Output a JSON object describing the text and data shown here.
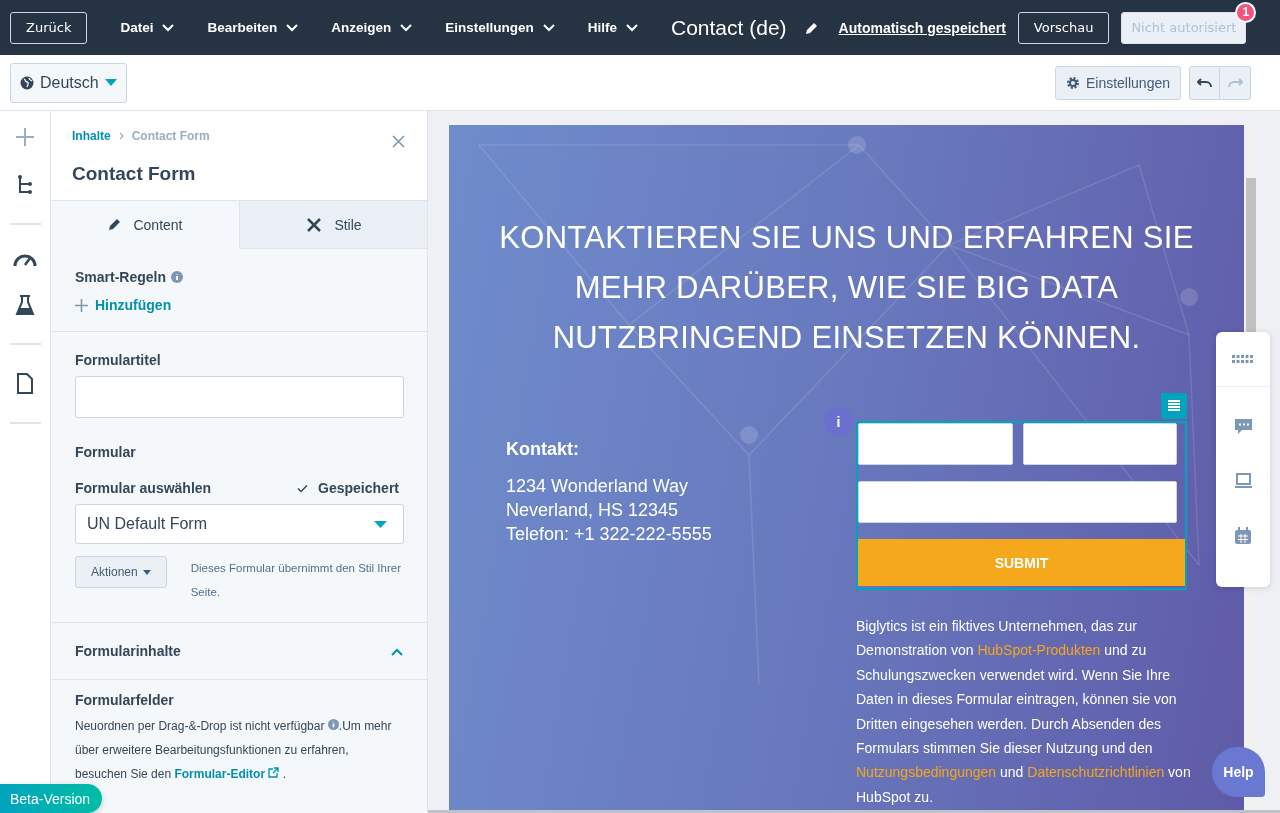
{
  "top_bar": {
    "back_button": "Zurück",
    "menus": [
      "Datei",
      "Bearbeiten",
      "Anzeigen",
      "Einstellungen",
      "Hilfe"
    ],
    "title": "Contact (de)",
    "autosave_link": "Automatisch gespeichert",
    "preview_button": "Vorschau",
    "publish_button": {
      "label": "Nicht autorisiert",
      "disabled": true
    },
    "notification_badge": "1"
  },
  "toolbar": {
    "language": "Deutsch",
    "settings_button": "Einstellungen",
    "history_buttons": [
      {
        "kind": "undo",
        "disabled": false
      },
      {
        "kind": "redo",
        "disabled": true
      }
    ]
  },
  "panel": {
    "breadcrumb": {
      "parent": "Inhalte",
      "current": "Contact Form"
    },
    "title": "Contact Form",
    "tabs": [
      {
        "label": "Content",
        "kind": "pencil",
        "selected": true
      },
      {
        "label": "Stile",
        "kind": "tools",
        "selected": false
      }
    ],
    "smart_rules": {
      "label": "Smart-Regeln",
      "add_link": "Hinzufügen"
    },
    "form_title": {
      "label": "Formulartitel"
    },
    "form_heading": "Formular",
    "form_select": {
      "label": "Formular auswählen",
      "status": "Gespeichert",
      "value": "UN Default Form"
    },
    "actions_button": "Aktionen",
    "style_note": "Dieses Formular übernimmt den Stil Ihrer Seite.",
    "form_contents": {
      "label": "Formularinhalte",
      "expanded": true
    },
    "form_fields": {
      "label": "Formularfelder",
      "note_start": "Neuordnen per Drag-&-Drop ist nicht verfügbar",
      "note_middle": ".Um mehr über erweitere Bearbeitungsfunktionen zu erfahren, besuchen Sie den",
      "editor_link": "Formular-Editor",
      "note_end": "."
    }
  },
  "preview": {
    "heading_lines": [
      "KONTAKTIEREN SIE UNS UND ERFAHREN SIE",
      "MEHR DARÜBER, WIE SIE BIG DATA",
      "NUTZBRINGEND EINSETZEN KÖNNEN."
    ],
    "contact": {
      "title": "Kontakt:",
      "lines": [
        "1234 Wonderland Way",
        "Neverland, HS 12345",
        "Telefon: +1 322-222-5555"
      ]
    },
    "form": {
      "info_badge": "i",
      "submit": "SUBMIT"
    },
    "disclaimer": [
      {
        "text": "Biglytics ist ein fiktives Unternehmen, das zur Demonstration von ",
        "kind": "text"
      },
      {
        "text": "HubSpot-Produkten",
        "kind": "link"
      },
      {
        "text": " und zu Schulungszwecken verwendet wird. Wenn Sie Ihre Daten in dieses Formular eintragen, können sie von Dritten eingesehen werden. Durch Absenden des Formulars stimmen Sie dieser Nutzung und den ",
        "kind": "text"
      },
      {
        "text": "Nutzungsbedingungen",
        "kind": "link"
      },
      {
        "text": " und ",
        "kind": "text"
      },
      {
        "text": "Datenschutzrichtlinien",
        "kind": "link"
      },
      {
        "text": " von HubSpot zu.",
        "kind": "text"
      }
    ]
  },
  "beta_button": "Beta-Version",
  "help_button": "Help"
}
